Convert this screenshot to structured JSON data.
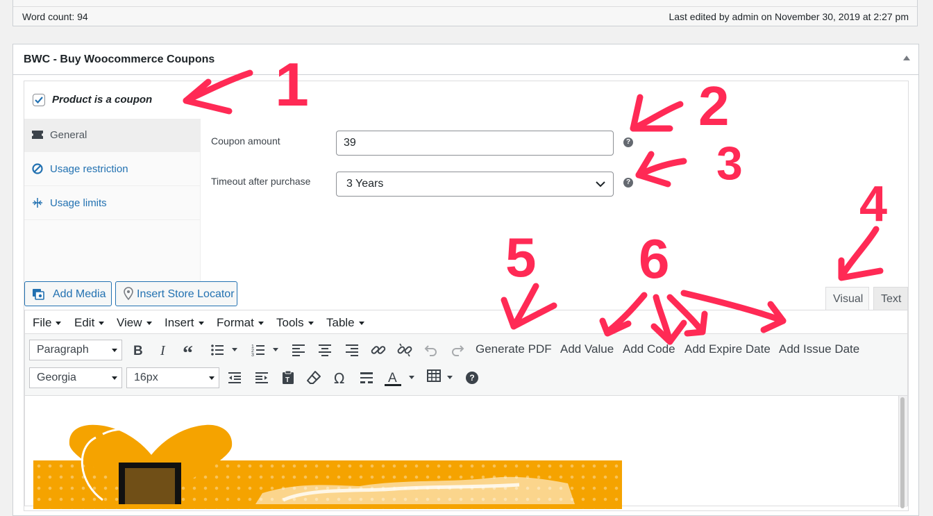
{
  "status_bar": {
    "word_count": "Word count: 94",
    "last_edited": "Last edited by admin on November 30, 2019 at 2:27 pm"
  },
  "metabox": {
    "title": "BWC - Buy Woocommerce Coupons",
    "product_is_coupon_label": "Product is a coupon",
    "product_is_coupon_checked": true,
    "tabs": [
      {
        "label": "General",
        "icon": "ticket-icon",
        "active": true
      },
      {
        "label": "Usage restriction",
        "icon": "block-icon",
        "active": false
      },
      {
        "label": "Usage limits",
        "icon": "limits-icon",
        "active": false
      }
    ],
    "fields": {
      "coupon_amount_label": "Coupon amount",
      "coupon_amount_value": "39",
      "timeout_label": "Timeout after purchase",
      "timeout_value": "3 Years",
      "help_glyph": "?"
    }
  },
  "editor": {
    "media_buttons": {
      "add_media": "Add Media",
      "insert_store_locator": "Insert Store Locator"
    },
    "mode_tabs": {
      "visual": "Visual",
      "text": "Text"
    },
    "menubar": [
      "File",
      "Edit",
      "View",
      "Insert",
      "Format",
      "Tools",
      "Table"
    ],
    "toolbar_row1": {
      "format_select": "Paragraph",
      "custom_buttons": [
        "Generate PDF",
        "Add Value",
        "Add Code",
        "Add Expire Date",
        "Add Issue Date"
      ]
    },
    "toolbar_row2": {
      "font_family": "Georgia",
      "font_size": "16px",
      "omega_glyph": "Ω",
      "text_color_glyph": "A",
      "help_glyph": "?"
    }
  },
  "annotations": [
    "1",
    "2",
    "3",
    "4",
    "5",
    "6"
  ],
  "colors": {
    "accent": "#2271b1",
    "annotation": "#ff2a55",
    "banner": "#f5a300"
  }
}
